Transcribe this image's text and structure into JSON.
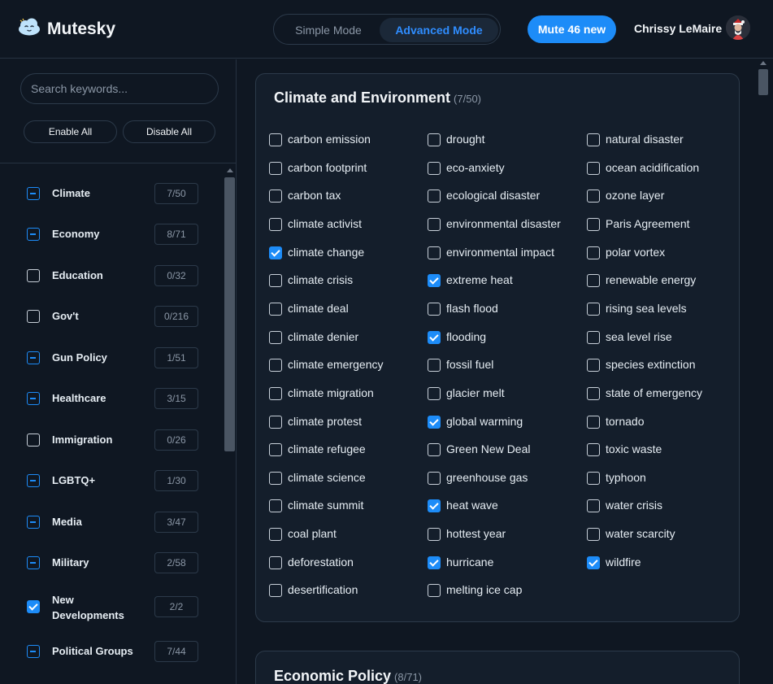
{
  "app": {
    "name": "Mutesky"
  },
  "header": {
    "mode_simple": "Simple Mode",
    "mode_advanced": "Advanced Mode",
    "mute_button": "Mute 46 new",
    "user_name": "Chrissy LeMaire"
  },
  "sidebar": {
    "search_placeholder": "Search keywords...",
    "enable_all": "Enable All",
    "disable_all": "Disable All",
    "categories": [
      {
        "label": "Climate",
        "count": "7/50",
        "state": "partial"
      },
      {
        "label": "Economy",
        "count": "8/71",
        "state": "partial"
      },
      {
        "label": "Education",
        "count": "0/32",
        "state": "empty"
      },
      {
        "label": "Gov't",
        "count": "0/216",
        "state": "empty"
      },
      {
        "label": "Gun Policy",
        "count": "1/51",
        "state": "partial"
      },
      {
        "label": "Healthcare",
        "count": "3/15",
        "state": "partial"
      },
      {
        "label": "Immigration",
        "count": "0/26",
        "state": "empty"
      },
      {
        "label": "LGBTQ+",
        "count": "1/30",
        "state": "partial"
      },
      {
        "label": "Media",
        "count": "3/47",
        "state": "partial"
      },
      {
        "label": "Military",
        "count": "2/58",
        "state": "partial"
      },
      {
        "label": "New Developments",
        "count": "2/2",
        "state": "checked"
      },
      {
        "label": "Political Groups",
        "count": "7/44",
        "state": "partial"
      }
    ]
  },
  "main": {
    "panels": [
      {
        "title": "Climate and Environment",
        "count": "(7/50)",
        "columns": [
          [
            {
              "label": "carbon emission",
              "checked": false
            },
            {
              "label": "carbon footprint",
              "checked": false
            },
            {
              "label": "carbon tax",
              "checked": false
            },
            {
              "label": "climate activist",
              "checked": false
            },
            {
              "label": "climate change",
              "checked": true
            },
            {
              "label": "climate crisis",
              "checked": false
            },
            {
              "label": "climate deal",
              "checked": false
            },
            {
              "label": "climate denier",
              "checked": false
            },
            {
              "label": "climate emergency",
              "checked": false
            },
            {
              "label": "climate migration",
              "checked": false
            },
            {
              "label": "climate protest",
              "checked": false
            },
            {
              "label": "climate refugee",
              "checked": false
            },
            {
              "label": "climate science",
              "checked": false
            },
            {
              "label": "climate summit",
              "checked": false
            },
            {
              "label": "coal plant",
              "checked": false
            },
            {
              "label": "deforestation",
              "checked": false
            },
            {
              "label": "desertification",
              "checked": false
            }
          ],
          [
            {
              "label": "drought",
              "checked": false
            },
            {
              "label": "eco-anxiety",
              "checked": false
            },
            {
              "label": "ecological disaster",
              "checked": false
            },
            {
              "label": "environmental disaster",
              "checked": false
            },
            {
              "label": "environmental impact",
              "checked": false
            },
            {
              "label": "extreme heat",
              "checked": true
            },
            {
              "label": "flash flood",
              "checked": false
            },
            {
              "label": "flooding",
              "checked": true
            },
            {
              "label": "fossil fuel",
              "checked": false
            },
            {
              "label": "glacier melt",
              "checked": false
            },
            {
              "label": "global warming",
              "checked": true
            },
            {
              "label": "Green New Deal",
              "checked": false
            },
            {
              "label": "greenhouse gas",
              "checked": false
            },
            {
              "label": "heat wave",
              "checked": true
            },
            {
              "label": "hottest year",
              "checked": false
            },
            {
              "label": "hurricane",
              "checked": true
            },
            {
              "label": "melting ice cap",
              "checked": false
            }
          ],
          [
            {
              "label": "natural disaster",
              "checked": false
            },
            {
              "label": "ocean acidification",
              "checked": false
            },
            {
              "label": "ozone layer",
              "checked": false
            },
            {
              "label": "Paris Agreement",
              "checked": false
            },
            {
              "label": "polar vortex",
              "checked": false
            },
            {
              "label": "renewable energy",
              "checked": false
            },
            {
              "label": "rising sea levels",
              "checked": false
            },
            {
              "label": "sea level rise",
              "checked": false
            },
            {
              "label": "species extinction",
              "checked": false
            },
            {
              "label": "state of emergency",
              "checked": false
            },
            {
              "label": "tornado",
              "checked": false
            },
            {
              "label": "toxic waste",
              "checked": false
            },
            {
              "label": "typhoon",
              "checked": false
            },
            {
              "label": "water crisis",
              "checked": false
            },
            {
              "label": "water scarcity",
              "checked": false
            },
            {
              "label": "wildfire",
              "checked": true
            }
          ]
        ]
      },
      {
        "title": "Economic Policy",
        "count": "(8/71)"
      }
    ]
  },
  "colors": {
    "accent": "#1d8cf8",
    "background": "#0f1722",
    "panel": "#141e2b",
    "border": "#2c3a4a"
  },
  "icons": {
    "logo": "cloud-face-icon",
    "avatar": "user-avatar"
  }
}
